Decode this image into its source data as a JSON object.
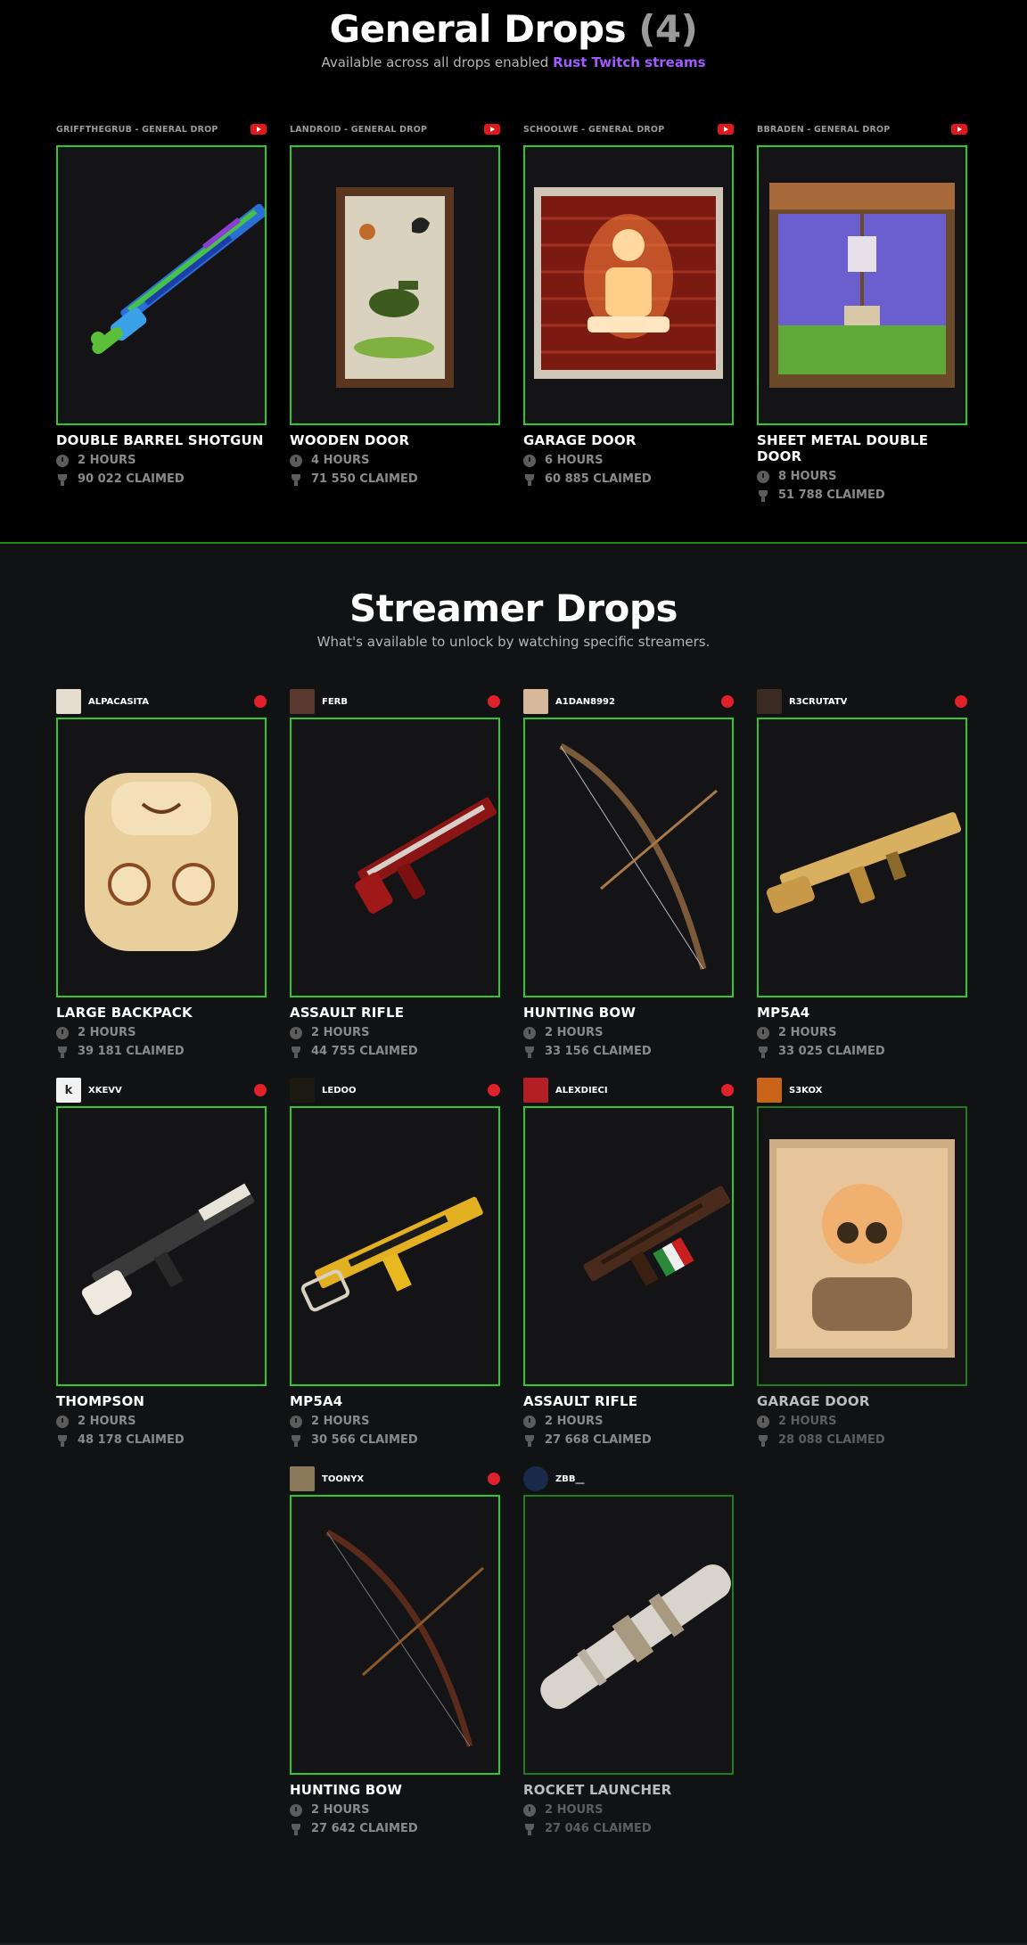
{
  "general": {
    "title": "General Drops",
    "count": "(4)",
    "subtitle": "Available across all drops enabled",
    "subtitle_link": "Rust Twitch streams",
    "cards": [
      {
        "source": "GRIFFTHEGRUB - GENERAL DROP",
        "item": "DOUBLE BARREL SHOTGUN",
        "hours": "2 HOURS",
        "claimed": "90 022 CLAIMED"
      },
      {
        "source": "LANDROID - GENERAL DROP",
        "item": "WOODEN DOOR",
        "hours": "4 HOURS",
        "claimed": "71 550 CLAIMED"
      },
      {
        "source": "SCHOOLWE - GENERAL DROP",
        "item": "GARAGE DOOR",
        "hours": "6 HOURS",
        "claimed": "60 885 CLAIMED"
      },
      {
        "source": "BBRADEN - GENERAL DROP",
        "item": "SHEET METAL DOUBLE DOOR",
        "hours": "8 HOURS",
        "claimed": "51 788 CLAIMED"
      }
    ]
  },
  "streamer": {
    "title": "Streamer Drops",
    "subtitle": "What's available to unlock by watching specific streamers.",
    "cards": [
      {
        "streamer": "ALPACASITA",
        "live": true,
        "item": "LARGE BACKPACK",
        "hours": "2 HOURS",
        "claimed": "39 181 CLAIMED"
      },
      {
        "streamer": "FERB",
        "live": true,
        "item": "ASSAULT RIFLE",
        "hours": "2 HOURS",
        "claimed": "44 755 CLAIMED"
      },
      {
        "streamer": "A1DAN8992",
        "live": true,
        "item": "HUNTING BOW",
        "hours": "2 HOURS",
        "claimed": "33 156 CLAIMED"
      },
      {
        "streamer": "R3CRUTATV",
        "live": true,
        "item": "MP5A4",
        "hours": "2 HOURS",
        "claimed": "33 025 CLAIMED"
      },
      {
        "streamer": "XKEVV",
        "live": true,
        "item": "THOMPSON",
        "hours": "2 HOURS",
        "claimed": "48 178 CLAIMED"
      },
      {
        "streamer": "LEDOO",
        "live": true,
        "item": "MP5A4",
        "hours": "2 HOURS",
        "claimed": "30 566 CLAIMED"
      },
      {
        "streamer": "ALEXDIECI",
        "live": true,
        "item": "ASSAULT RIFLE",
        "hours": "2 HOURS",
        "claimed": "27 668 CLAIMED"
      },
      {
        "streamer": "S3KOX",
        "live": false,
        "item": "GARAGE DOOR",
        "hours": "2 HOURS",
        "claimed": "28 088 CLAIMED"
      },
      {
        "streamer": "TOONYX",
        "live": true,
        "item": "HUNTING BOW",
        "hours": "2 HOURS",
        "claimed": "27 642 CLAIMED"
      },
      {
        "streamer": "ZBB__",
        "live": false,
        "item": "ROCKET LAUNCHER",
        "hours": "2 HOURS",
        "claimed": "27 046 CLAIMED"
      }
    ]
  },
  "colors": {
    "accent_green": "#2fc72f",
    "live_red": "#e0202a",
    "link_purple": "#a15cff",
    "youtube_red": "#e0171c"
  },
  "icons": [
    "youtube-icon",
    "live-dot-icon",
    "clock-icon",
    "trophy-icon"
  ]
}
